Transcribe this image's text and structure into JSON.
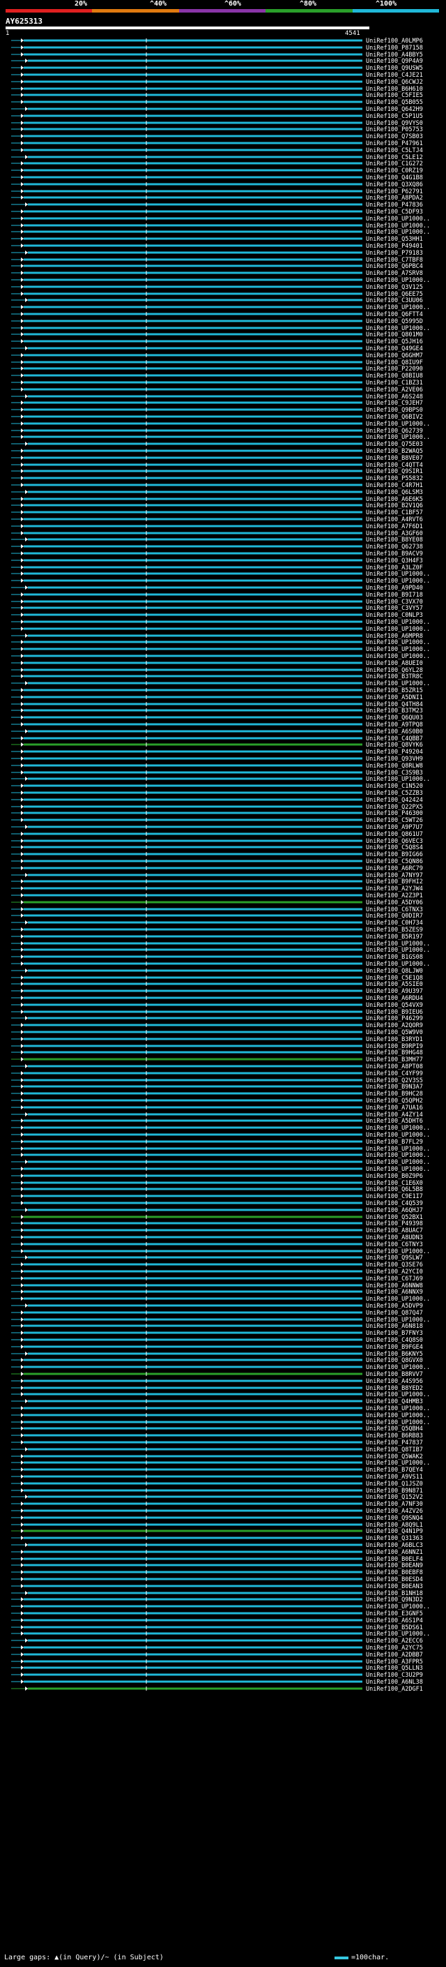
{
  "scale": {
    "ticks": [
      "20%",
      "^40%",
      "^60%",
      "^80%",
      "^100%"
    ],
    "colors": [
      "#e02020",
      "#e07a10",
      "#8a35a8",
      "#2a9f2a",
      "#20b8d8"
    ]
  },
  "query": {
    "name": "AY625313",
    "start": "1",
    "end": "4541"
  },
  "legend": {
    "left_text": "Large gaps: ▲(in Query)/~ (in Subject)",
    "right_text": "=100char."
  },
  "hits": [
    "UniRef100_A0LMP6",
    "UniRef100_P87158",
    "UniRef100_A4BBY5",
    "UniRef100_Q9P4A9",
    "UniRef100_Q9USW5",
    "UniRef100_C4JE21",
    "UniRef100_Q6CWJ2",
    "UniRef100_B6H610",
    "UniRef100_C5FIE5",
    "UniRef100_Q5B055",
    "UniRef100_Q642H9",
    "UniRef100_C5P1U5",
    "UniRef100_Q9VYS0",
    "UniRef100_P05753",
    "UniRef100_Q7SB03",
    "UniRef100_P47961",
    "UniRef100_C5LTJ4",
    "UniRef100_C5LE12",
    "UniRef100_C1G272",
    "UniRef100_C0RZ19",
    "UniRef100_Q4G1B8",
    "UniRef100_Q3XQ86",
    "UniRef100_P62791",
    "UniRef100_A8PDA2",
    "UniRef100_P47836",
    "UniRef100_C5DF93",
    "UniRef100_UP1000..",
    "UniRef100_UP1000..",
    "UniRef100_UP1000..",
    "UniRef100_Q53HH1",
    "UniRef100_P49401",
    "UniRef100_P79183",
    "UniRef100_C7TBF8",
    "UniRef100_Q6PBC4",
    "UniRef100_A7SRV8",
    "UniRef100_UP1000..",
    "UniRef100_Q3V125",
    "UniRef100_Q6EE75",
    "UniRef100_C3UU06",
    "UniRef100_UP1000..",
    "UniRef100_Q6FTT4",
    "UniRef100_Q5995D",
    "UniRef100_UP1000..",
    "UniRef100_Q801M0",
    "UniRef100_Q5JH16",
    "UniRef100_Q49GE4",
    "UniRef100_Q6GHM7",
    "UniRef100_Q8IU9F",
    "UniRef100_P22090",
    "UniRef100_Q8BIU8",
    "UniRef100_C1BZ31",
    "UniRef100_A2VE06",
    "UniRef100_A6S248",
    "UniRef100_C9JEH7",
    "UniRef100_Q9BPS0",
    "UniRef100_Q6BIV2",
    "UniRef100_UP1000..",
    "UniRef100_Q62739",
    "UniRef100_UP1000..",
    "UniRef100_Q75E03",
    "UniRef100_B2WAQ5",
    "UniRef100_B8VE07",
    "UniRef100_C4QTT4",
    "UniRef100_Q9SIR1",
    "UniRef100_P55832",
    "UniRef100_C4R7H1",
    "UniRef100_Q6LSM3",
    "UniRef100_A6E6K5",
    "UniRef100_B2V1Q6",
    "UniRef100_C1BF57",
    "UniRef100_A4RVT6",
    "UniRef100_A7F6D1",
    "UniRef100_A3GF60",
    "UniRef100_B8YE08",
    "UniRef100_Q62738",
    "UniRef100_B9ACV9",
    "UniRef100_Q3H4F3",
    "UniRef100_A3LZ0F",
    "UniRef100_UP1000..",
    "UniRef100_UP1000..",
    "UniRef100_A9PD40",
    "UniRef100_B9I718",
    "UniRef100_C3VX70",
    "UniRef100_C3VY57",
    "UniRef100_C0NLP3",
    "UniRef100_UP1000..",
    "UniRef100_UP1000..",
    "UniRef100_A6MPR8",
    "UniRef100_UP1000..",
    "UniRef100_UP1000..",
    "UniRef100_UP1000..",
    "UniRef100_A8UEI0",
    "UniRef100_Q6YL28",
    "UniRef100_B3TR8C",
    "UniRef100_UP1000..",
    "UniRef100_B5ZR15",
    "UniRef100_A5DNI1",
    "UniRef100_Q4TH84",
    "UniRef100_B3TM23",
    "UniRef100_Q6QU03",
    "UniRef100_A9TPQ8",
    "UniRef100_A6S0B0",
    "UniRef100_C4QBB7",
    "UniRef100_Q8VYK6",
    "UniRef100_P49204",
    "UniRef100_Q93VH9",
    "UniRef100_Q8RLW8",
    "UniRef100_C3S9B3",
    "UniRef100_UP1000..",
    "UniRef100_C1N520",
    "UniRef100_C5ZZB3",
    "UniRef100_Q42424",
    "UniRef100_Q22PX5",
    "UniRef100_P46300",
    "UniRef100_C5WT26",
    "UniRef100_A9P7U7",
    "UniRef100_Q861U7",
    "UniRef100_Q6VEC3",
    "UniRef100_C5Q8S4",
    "UniRef100_B9IG66",
    "UniRef100_C5QN86",
    "UniRef100_A6RC79",
    "UniRef100_A7NY97",
    "UniRef100_B9FHI2",
    "UniRef100_A2YJW4",
    "UniRef100_A2Z3P1",
    "UniRef100_A5DY06",
    "UniRef100_C6TNX3",
    "UniRef100_Q0DIR7",
    "UniRef100_C0H734",
    "UniRef100_B5ZES9",
    "UniRef100_B5R197",
    "UniRef100_UP1000..",
    "UniRef100_UP1000..",
    "UniRef100_B1GS08",
    "UniRef100_UP1000..",
    "UniRef100_Q8LJW0",
    "UniRef100_C5E1Q8",
    "UniRef100_A5SIE0",
    "UniRef100_A9U397",
    "UniRef100_A6RDU4",
    "UniRef100_Q54VX9",
    "UniRef100_B9IEU6",
    "UniRef100_P46299",
    "UniRef100_A2QOR9",
    "UniRef100_Q5W9V0",
    "UniRef100_B3RYD1",
    "UniRef100_B9RPI9",
    "UniRef100_B9HG48",
    "UniRef100_B3MH77",
    "UniRef100_A8PT08",
    "UniRef100_C4YF99",
    "UniRef100_Q2V3S5",
    "UniRef100_B9N3A7",
    "UniRef100_B9HC28",
    "UniRef100_Q5QPH2",
    "UniRef100_A7UA16",
    "UniRef100_A4ZY14",
    "UniRef100_A5DHT6",
    "UniRef100_UP1000..",
    "UniRef100_UP1000..",
    "UniRef100_B7FL29",
    "UniRef100_UP1000..",
    "UniRef100_UP1000..",
    "UniRef100_UP1000..",
    "UniRef100_UP1000..",
    "UniRef100_B0Z9P6",
    "UniRef100_C1E6X0",
    "UniRef100_Q6L5B8",
    "UniRef100_C9E1I7",
    "UniRef100_C4Q539",
    "UniRef100_A6QHJ7",
    "UniRef100_Q52BX1",
    "UniRef100_P49398",
    "UniRef100_A8UAC7",
    "UniRef100_A8UDN3",
    "UniRef100_C6TNY3",
    "UniRef100_UP1000..",
    "UniRef100_Q9SLW7",
    "UniRef100_Q3SE76",
    "UniRef100_A2YCI0",
    "UniRef100_C6TJ69",
    "UniRef100_A6NNW8",
    "UniRef100_A6NNX9",
    "UniRef100_UP1000..",
    "UniRef100_A5DVP9",
    "UniRef100_Q87Q47",
    "UniRef100_UP1000..",
    "UniRef100_A6N818",
    "UniRef100_B7FNY3",
    "UniRef100_C4Q8S0",
    "UniRef100_B9FGE4",
    "UniRef100_B6KNY5",
    "UniRef100_Q8GVX0",
    "UniRef100_UP1000..",
    "UniRef100_B8RVV7",
    "UniRef100_A4S956",
    "UniRef100_B8YED2",
    "UniRef100_UP1000..",
    "UniRef100_Q4HMB3",
    "UniRef100_UP1000..",
    "UniRef100_UP1000..",
    "UniRef100_UP1000..",
    "UniRef100_Q5QBH4",
    "UniRef100_B6RB83",
    "UniRef100_P47837",
    "UniRef100_Q8TIB7",
    "UniRef100_Q5WAK2",
    "UniRef100_UP1000..",
    "UniRef100_B7QEY4",
    "UniRef100_A9VS11",
    "UniRef100_Q1JSZ0",
    "UniRef100_B9N871",
    "UniRef100_Q152V2",
    "UniRef100_A7NF30",
    "UniRef100_A4ZV26",
    "UniRef100_Q9SNQ4",
    "UniRef100_A8Q9L1",
    "UniRef100_Q4N1P9",
    "UniRef100_Q31363",
    "UniRef100_A6BLC3",
    "UniRef100_A6NNZ1",
    "UniRef100_B0ELF4",
    "UniRef100_B0EAN9",
    "UniRef100_B0EBF8",
    "UniRef100_B0ESD4",
    "UniRef100_B0EAN3",
    "UniRef100_B1NH18",
    "UniRef100_Q9N3D2",
    "UniRef100_UP1000..",
    "UniRef100_E3GNF5",
    "UniRef100_A6S1P4",
    "UniRef100_B5DS61",
    "UniRef100_UP1000..",
    "UniRef100_A2ECC6",
    "UniRef100_A2YC75",
    "UniRef100_A2DBB7",
    "UniRef100_A3FPR5",
    "UniRef100_Q5LLN3",
    "UniRef100_C3U2P9",
    "UniRef100_A6NL38",
    "UniRef100_A2DGF1"
  ]
}
